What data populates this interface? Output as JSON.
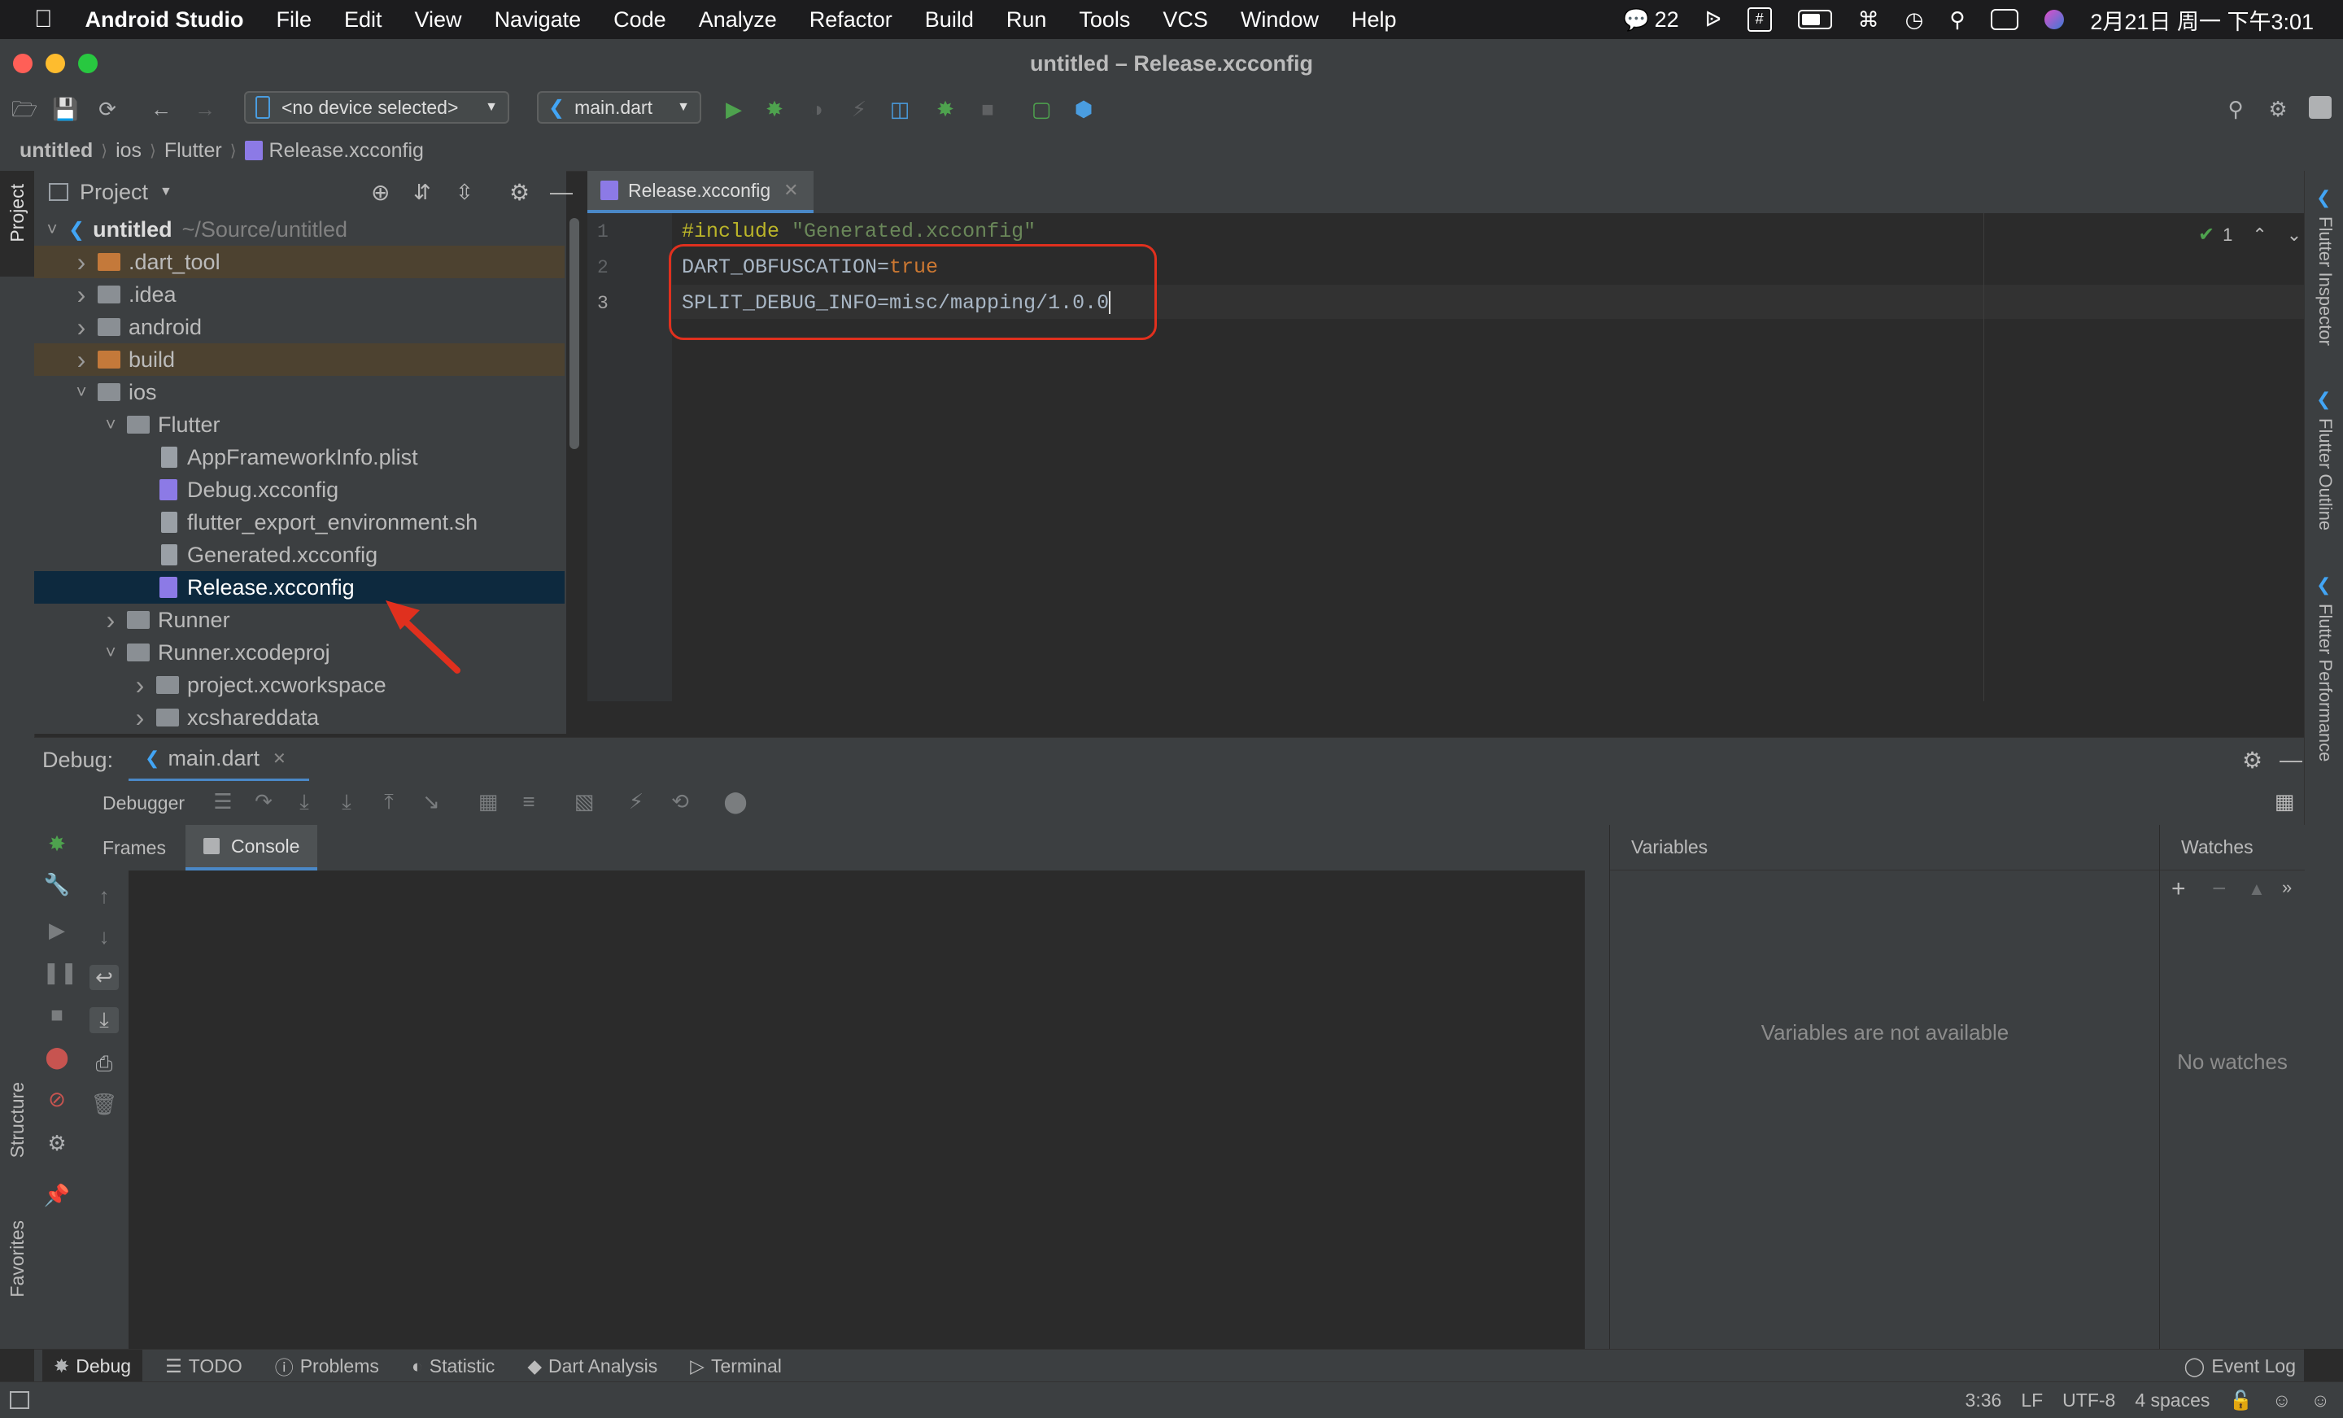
{
  "menubar": {
    "app": "Android Studio",
    "items": [
      "File",
      "Edit",
      "View",
      "Navigate",
      "Code",
      "Analyze",
      "Refactor",
      "Build",
      "Run",
      "Tools",
      "VCS",
      "Window",
      "Help"
    ],
    "notif_count": "22",
    "datetime": "2月21日 周一 下午3:01"
  },
  "window": {
    "title": "untitled – Release.xcconfig"
  },
  "toolbar": {
    "device": "<no device selected>",
    "run_config": "main.dart"
  },
  "breadcrumb": [
    "untitled",
    "ios",
    "Flutter",
    "Release.xcconfig"
  ],
  "project": {
    "header": "Project",
    "tree": [
      {
        "label": "untitled",
        "extra": "~/Source/untitled",
        "depth": 0,
        "arrow": "v",
        "kind": "flutter"
      },
      {
        "label": ".dart_tool",
        "depth": 1,
        "arrow": ">",
        "kind": "folder-orange"
      },
      {
        "label": ".idea",
        "depth": 1,
        "arrow": ">",
        "kind": "folder"
      },
      {
        "label": "android",
        "depth": 1,
        "arrow": ">",
        "kind": "folder"
      },
      {
        "label": "build",
        "depth": 1,
        "arrow": ">",
        "kind": "folder-orange"
      },
      {
        "label": "ios",
        "depth": 1,
        "arrow": "v",
        "kind": "folder"
      },
      {
        "label": "Flutter",
        "depth": 2,
        "arrow": "v",
        "kind": "folder"
      },
      {
        "label": "AppFrameworkInfo.plist",
        "depth": 3,
        "arrow": "",
        "kind": "file"
      },
      {
        "label": "Debug.xcconfig",
        "depth": 3,
        "arrow": "",
        "kind": "filep"
      },
      {
        "label": "flutter_export_environment.sh",
        "depth": 3,
        "arrow": "",
        "kind": "file"
      },
      {
        "label": "Generated.xcconfig",
        "depth": 3,
        "arrow": "",
        "kind": "file"
      },
      {
        "label": "Release.xcconfig",
        "depth": 3,
        "arrow": "",
        "kind": "filep",
        "selected": true
      },
      {
        "label": "Runner",
        "depth": 2,
        "arrow": ">",
        "kind": "folder"
      },
      {
        "label": "Runner.xcodeproj",
        "depth": 2,
        "arrow": "v",
        "kind": "folder"
      },
      {
        "label": "project.xcworkspace",
        "depth": 3,
        "arrow": ">",
        "kind": "folder"
      },
      {
        "label": "xcshareddata",
        "depth": 3,
        "arrow": ">",
        "kind": "folder"
      }
    ]
  },
  "editor": {
    "tab": "Release.xcconfig",
    "line_numbers": [
      "1",
      "2",
      "3"
    ],
    "lines": [
      {
        "a": "#include ",
        "b": "\"Generated.xcconfig\""
      },
      {
        "a": "DART_OBFUSCATION=",
        "b": "true"
      },
      {
        "a": "SPLIT_DEBUG_INFO=misc/mapping/1.0.0",
        "b": ""
      }
    ],
    "inspection_count": "1"
  },
  "right_stripe": [
    "Flutter Inspector",
    "Flutter Outline",
    "Flutter Performance"
  ],
  "left_stripe": [
    "Project",
    "Structure",
    "Favorites"
  ],
  "debug": {
    "label": "Debug:",
    "session": "main.dart",
    "debugger_tab": "Debugger",
    "frames_tab": "Frames",
    "console_tab": "Console",
    "variables_title": "Variables",
    "variables_empty": "Variables are not available",
    "watches_title": "Watches",
    "watches_empty": "No watches"
  },
  "bottom_tools": [
    "Debug",
    "TODO",
    "Problems",
    "Statistic",
    "Dart Analysis",
    "Terminal"
  ],
  "event_log": "Event Log",
  "status": {
    "position": "3:36",
    "line_sep": "LF",
    "encoding": "UTF-8",
    "indent": "4 spaces"
  },
  "colors": {
    "accent": "#4a88c7",
    "selection": "#0d293e",
    "annotation": "#e0301e"
  }
}
